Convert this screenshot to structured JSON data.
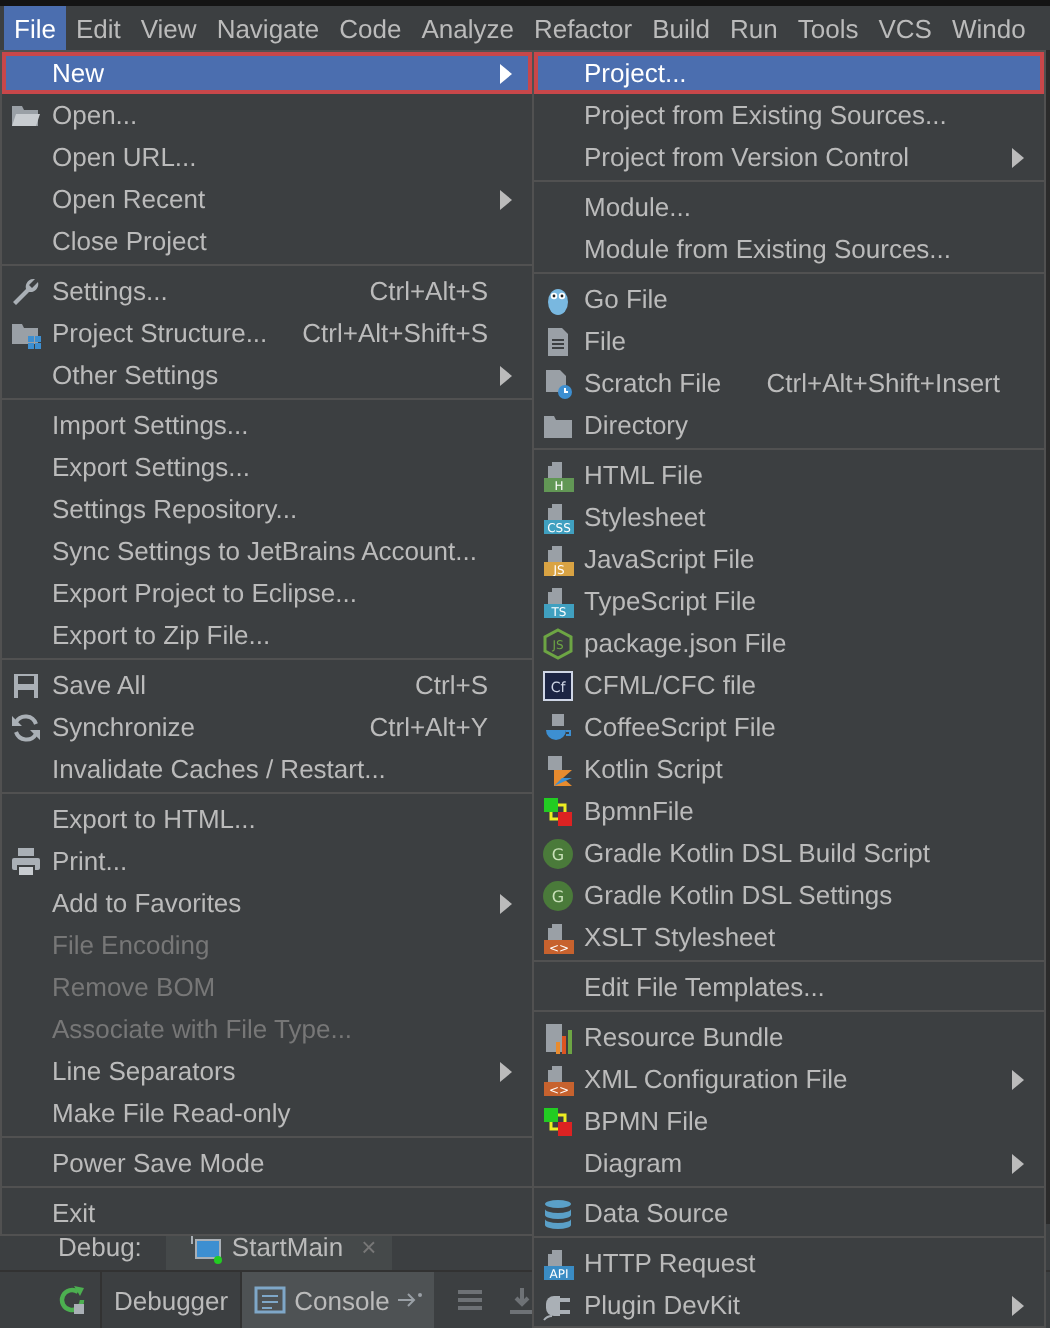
{
  "menu_bar": [
    {
      "label": "File",
      "selected": true
    },
    {
      "label": "Edit",
      "selected": false
    },
    {
      "label": "View",
      "selected": false
    },
    {
      "label": "Navigate",
      "selected": false
    },
    {
      "label": "Code",
      "selected": false
    },
    {
      "label": "Analyze",
      "selected": false
    },
    {
      "label": "Refactor",
      "selected": false
    },
    {
      "label": "Build",
      "selected": false
    },
    {
      "label": "Run",
      "selected": false
    },
    {
      "label": "Tools",
      "selected": false
    },
    {
      "label": "VCS",
      "selected": false
    },
    {
      "label": "Windo",
      "selected": false
    }
  ],
  "file_menu": {
    "items": [
      {
        "kind": "item",
        "label": "New",
        "selected": true,
        "submenu": true,
        "disabled": false
      },
      {
        "kind": "item",
        "label": "Open...",
        "selected": false,
        "submenu": false,
        "disabled": false
      },
      {
        "kind": "item",
        "label": "Open URL...",
        "selected": false,
        "submenu": false,
        "disabled": false
      },
      {
        "kind": "item",
        "label": "Open Recent",
        "selected": false,
        "submenu": true,
        "disabled": false
      },
      {
        "kind": "item",
        "label": "Close Project",
        "selected": false,
        "submenu": false,
        "disabled": false
      },
      {
        "kind": "separator"
      },
      {
        "kind": "item",
        "label": "Settings...",
        "shortcut": "Ctrl+Alt+S",
        "selected": false,
        "submenu": false,
        "disabled": false
      },
      {
        "kind": "item",
        "label": "Project Structure...",
        "shortcut": "Ctrl+Alt+Shift+S",
        "selected": false,
        "submenu": false,
        "disabled": false
      },
      {
        "kind": "item",
        "label": "Other Settings",
        "selected": false,
        "submenu": true,
        "disabled": false
      },
      {
        "kind": "separator"
      },
      {
        "kind": "item",
        "label": "Import Settings...",
        "selected": false,
        "submenu": false,
        "disabled": false
      },
      {
        "kind": "item",
        "label": "Export Settings...",
        "selected": false,
        "submenu": false,
        "disabled": false
      },
      {
        "kind": "item",
        "label": "Settings Repository...",
        "selected": false,
        "submenu": false,
        "disabled": false
      },
      {
        "kind": "item",
        "label": "Sync Settings to JetBrains Account...",
        "selected": false,
        "submenu": false,
        "disabled": false
      },
      {
        "kind": "item",
        "label": "Export Project to Eclipse...",
        "selected": false,
        "submenu": false,
        "disabled": false
      },
      {
        "kind": "item",
        "label": "Export to Zip File...",
        "selected": false,
        "submenu": false,
        "disabled": false
      },
      {
        "kind": "separator"
      },
      {
        "kind": "item",
        "label": "Save All",
        "shortcut": "Ctrl+S",
        "selected": false,
        "submenu": false,
        "disabled": false
      },
      {
        "kind": "item",
        "label": "Synchronize",
        "shortcut": "Ctrl+Alt+Y",
        "selected": false,
        "submenu": false,
        "disabled": false
      },
      {
        "kind": "item",
        "label": "Invalidate Caches / Restart...",
        "selected": false,
        "submenu": false,
        "disabled": false
      },
      {
        "kind": "separator"
      },
      {
        "kind": "item",
        "label": "Export to HTML...",
        "selected": false,
        "submenu": false,
        "disabled": false
      },
      {
        "kind": "item",
        "label": "Print...",
        "selected": false,
        "submenu": false,
        "disabled": false
      },
      {
        "kind": "item",
        "label": "Add to Favorites",
        "selected": false,
        "submenu": true,
        "disabled": false
      },
      {
        "kind": "item",
        "label": "File Encoding",
        "selected": false,
        "submenu": false,
        "disabled": true
      },
      {
        "kind": "item",
        "label": "Remove BOM",
        "selected": false,
        "submenu": false,
        "disabled": true
      },
      {
        "kind": "item",
        "label": "Associate with File Type...",
        "selected": false,
        "submenu": false,
        "disabled": true
      },
      {
        "kind": "item",
        "label": "Line Separators",
        "selected": false,
        "submenu": true,
        "disabled": false
      },
      {
        "kind": "item",
        "label": "Make File Read-only",
        "selected": false,
        "submenu": false,
        "disabled": false
      },
      {
        "kind": "separator"
      },
      {
        "kind": "item",
        "label": "Power Save Mode",
        "selected": false,
        "submenu": false,
        "disabled": false
      },
      {
        "kind": "separator"
      },
      {
        "kind": "item",
        "label": "Exit",
        "selected": false,
        "submenu": false,
        "disabled": false
      }
    ]
  },
  "new_submenu": {
    "items": [
      {
        "kind": "item",
        "label": "Project...",
        "selected": true,
        "submenu": false
      },
      {
        "kind": "item",
        "label": "Project from Existing Sources...",
        "selected": false,
        "submenu": false
      },
      {
        "kind": "item",
        "label": "Project from Version Control",
        "selected": false,
        "submenu": true
      },
      {
        "kind": "separator"
      },
      {
        "kind": "item",
        "label": "Module...",
        "selected": false,
        "submenu": false
      },
      {
        "kind": "item",
        "label": "Module from Existing Sources...",
        "selected": false,
        "submenu": false
      },
      {
        "kind": "separator"
      },
      {
        "kind": "item",
        "label": "Go File",
        "selected": false,
        "submenu": false
      },
      {
        "kind": "item",
        "label": "File",
        "selected": false,
        "submenu": false
      },
      {
        "kind": "item",
        "label": "Scratch File",
        "shortcut": "Ctrl+Alt+Shift+Insert",
        "selected": false,
        "submenu": false
      },
      {
        "kind": "item",
        "label": "Directory",
        "selected": false,
        "submenu": false
      },
      {
        "kind": "separator"
      },
      {
        "kind": "item",
        "label": "HTML File",
        "badge": "H",
        "selected": false,
        "submenu": false
      },
      {
        "kind": "item",
        "label": "Stylesheet",
        "badge": "CSS",
        "selected": false,
        "submenu": false
      },
      {
        "kind": "item",
        "label": "JavaScript File",
        "badge": "JS",
        "selected": false,
        "submenu": false
      },
      {
        "kind": "item",
        "label": "TypeScript File",
        "badge": "TS",
        "selected": false,
        "submenu": false
      },
      {
        "kind": "item",
        "label": "package.json File",
        "badge": "JS",
        "selected": false,
        "submenu": false
      },
      {
        "kind": "item",
        "label": "CFML/CFC file",
        "badge": "Cf",
        "selected": false,
        "submenu": false
      },
      {
        "kind": "item",
        "label": "CoffeeScript File",
        "selected": false,
        "submenu": false
      },
      {
        "kind": "item",
        "label": "Kotlin Script",
        "selected": false,
        "submenu": false
      },
      {
        "kind": "item",
        "label": "BpmnFile",
        "selected": false,
        "submenu": false
      },
      {
        "kind": "item",
        "label": "Gradle Kotlin DSL Build Script",
        "badge": "G",
        "selected": false,
        "submenu": false
      },
      {
        "kind": "item",
        "label": "Gradle Kotlin DSL Settings",
        "badge": "G",
        "selected": false,
        "submenu": false
      },
      {
        "kind": "item",
        "label": "XSLT Stylesheet",
        "badge": "<>",
        "selected": false,
        "submenu": false
      },
      {
        "kind": "separator"
      },
      {
        "kind": "item",
        "label": "Edit File Templates...",
        "selected": false,
        "submenu": false
      },
      {
        "kind": "separator"
      },
      {
        "kind": "item",
        "label": "Resource Bundle",
        "selected": false,
        "submenu": false
      },
      {
        "kind": "item",
        "label": "XML Configuration File",
        "badge": "<>",
        "selected": false,
        "submenu": true
      },
      {
        "kind": "item",
        "label": "BPMN File",
        "selected": false,
        "submenu": false
      },
      {
        "kind": "item",
        "label": "Diagram",
        "selected": false,
        "submenu": true
      },
      {
        "kind": "separator"
      },
      {
        "kind": "item",
        "label": "Data Source",
        "selected": false,
        "submenu": false
      },
      {
        "kind": "separator"
      },
      {
        "kind": "item",
        "label": "HTTP Request",
        "badge": "API",
        "selected": false,
        "submenu": false
      },
      {
        "kind": "item",
        "label": "Plugin DevKit",
        "selected": false,
        "submenu": true
      }
    ]
  },
  "debug_panel": {
    "label": "Debug:",
    "session": {
      "label": "StartMain",
      "close": "×"
    },
    "tabs": [
      {
        "label": "Debugger",
        "selected": false
      },
      {
        "label": "Console",
        "selected": true
      }
    ]
  }
}
